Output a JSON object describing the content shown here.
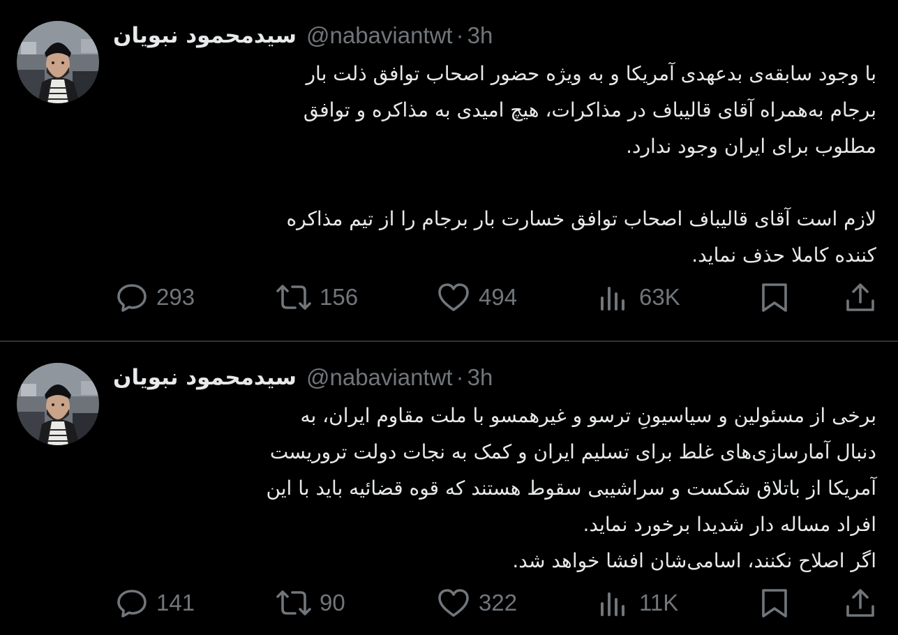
{
  "colors": {
    "background": "#000000",
    "text": "#e7e9ea",
    "secondary": "#71767b",
    "divider": "#2f3336"
  },
  "icons": {
    "reply": "reply-icon",
    "retweet": "retweet-icon",
    "like": "like-icon",
    "views": "views-icon",
    "bookmark": "bookmark-icon",
    "share": "share-icon"
  },
  "tweets": [
    {
      "author": {
        "name": "سیدمحمود نبویان",
        "handle": "@nabaviantwt",
        "separator": "·",
        "time": "3h"
      },
      "paragraphs": [
        [
          "با وجود سابقه‌ی بدعهدی آمریکا و به ویژه حضور اصحاب توافق ذلت بار",
          "برجام به‌همراه  آقای قالیباف در مذاکرات، هیچ امیدی به مذاکره و توافق",
          "مطلوب برای ایران وجود ندارد."
        ],
        [
          "لازم است آقای قالیباف  اصحاب توافق خسارت بار برجام را از تیم مذاکره",
          "کننده کاملا حذف نماید."
        ]
      ],
      "stats": {
        "replies": "293",
        "retweets": "156",
        "likes": "494",
        "views": "63K"
      }
    },
    {
      "author": {
        "name": "سیدمحمود نبویان",
        "handle": "@nabaviantwt",
        "separator": "·",
        "time": "3h"
      },
      "paragraphs": [
        [
          "برخی از مسئولین و سیاسیونِ ترسو و  غیرهمسو با ملت مقاوم ایران، به",
          "دنبال آمارسازی‌های غلط برای تسلیم ایران و کمک به نجات دولت تروریست",
          "آمریکا از باتلاق شکست و سراشیبی سقوط هستند که قوه قضائیه باید با این",
          "افراد مساله دار شدیدا برخورد نماید.",
          "اگر اصلاح نکنند، اسامی‌شان افشا خواهد شد."
        ]
      ],
      "stats": {
        "replies": "141",
        "retweets": "90",
        "likes": "322",
        "views": "11K"
      }
    }
  ]
}
